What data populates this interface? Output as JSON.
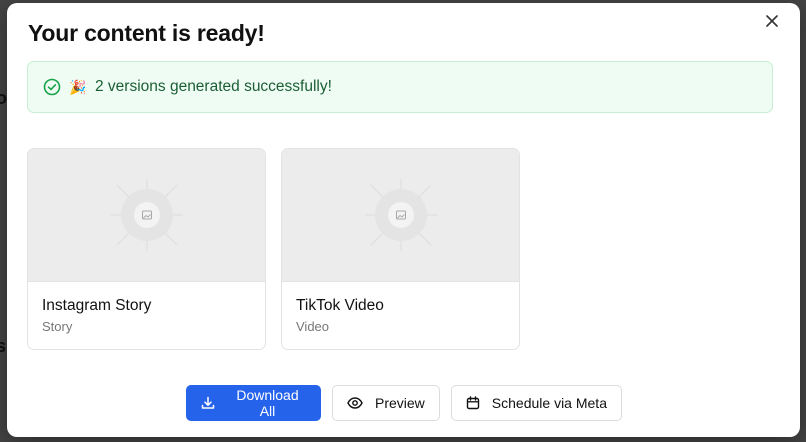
{
  "modal": {
    "title": "Your content is ready!",
    "close_icon": "close-icon"
  },
  "banner": {
    "icon": "check-circle-icon",
    "emoji": "🎉",
    "message": "2 versions generated successfully!"
  },
  "versions": [
    {
      "title": "Instagram Story",
      "type": "Story",
      "thumb_icon": "image-placeholder-icon"
    },
    {
      "title": "TikTok Video",
      "type": "Video",
      "thumb_icon": "image-placeholder-icon"
    }
  ],
  "actions": {
    "download_all": {
      "label": "Download All",
      "icon": "download-icon"
    },
    "preview": {
      "label": "Preview",
      "icon": "eye-icon"
    },
    "schedule": {
      "label": "Schedule via Meta",
      "icon": "calendar-icon"
    }
  },
  "colors": {
    "primary": "#2563eb",
    "success_bg": "#effcf3",
    "success_border": "#c6efd3",
    "success_text": "#1b5e35",
    "success_icon": "#16a34a"
  }
}
